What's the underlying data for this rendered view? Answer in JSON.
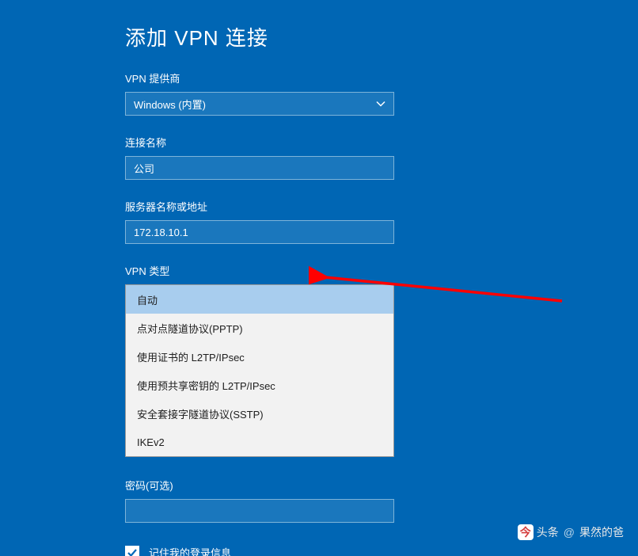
{
  "title": "添加 VPN 连接",
  "provider": {
    "label": "VPN 提供商",
    "value": "Windows (内置)"
  },
  "connectionName": {
    "label": "连接名称",
    "value": "公司"
  },
  "serverAddress": {
    "label": "服务器名称或地址",
    "value": "172.18.10.1"
  },
  "vpnType": {
    "label": "VPN 类型",
    "options": [
      "自动",
      "点对点隧道协议(PPTP)",
      "使用证书的 L2TP/IPsec",
      "使用预共享密钥的 L2TP/IPsec",
      "安全套接字隧道协议(SSTP)",
      "IKEv2"
    ],
    "highlightedIndex": 0
  },
  "password": {
    "label": "密码(可选)",
    "value": ""
  },
  "remember": {
    "label": "记住我的登录信息",
    "checked": true
  },
  "watermark": {
    "brand": "头条",
    "at": "@",
    "author": "果然的爸"
  }
}
